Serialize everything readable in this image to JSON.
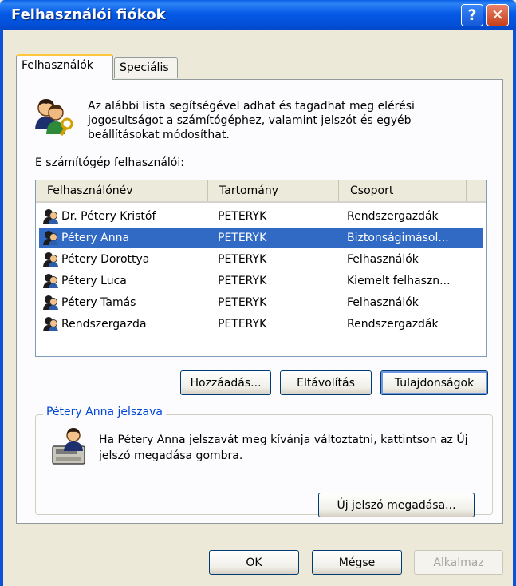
{
  "window": {
    "title": "Felhasználói fiókok",
    "help_label": "?",
    "close_label": "✕"
  },
  "tabs": [
    "Felhasználók",
    "Speciális"
  ],
  "intro": "Az alábbi lista segítségével adhat és tagadhat meg elérési jogosultságot a számítógéphez, valamint jelszót és egyéb beállításokat módosíthat.",
  "users_label": "E számítógép felhasználói:",
  "columns": [
    "Felhasználónév",
    "Tartomány",
    "Csoport"
  ],
  "users": [
    {
      "name": "Dr. Pétery Kristóf",
      "domain": "PETERYK",
      "group": "Rendszergazdák"
    },
    {
      "name": "Pétery Anna",
      "domain": "PETERYK",
      "group": "Biztonságimásol..."
    },
    {
      "name": "Pétery Dorottya",
      "domain": "PETERYK",
      "group": "Felhasználók"
    },
    {
      "name": "Pétery Luca",
      "domain": "PETERYK",
      "group": "Kiemelt felhaszn..."
    },
    {
      "name": "Pétery Tamás",
      "domain": "PETERYK",
      "group": "Felhasználók"
    },
    {
      "name": "Rendszergazda",
      "domain": "PETERYK",
      "group": "Rendszergazdák"
    }
  ],
  "selected_user_index": 1,
  "list_buttons": {
    "add": "Hozzáadás...",
    "remove": "Eltávolítás",
    "properties": "Tulajdonságok"
  },
  "password_group": {
    "label": "Pétery Anna jelszava",
    "text": "Ha Pétery Anna jelszavát meg kívánja változtatni, kattintson az Új jelszó megadása gombra.",
    "button": "Új jelszó megadása..."
  },
  "dialog_buttons": {
    "ok": "OK",
    "cancel": "Mégse",
    "apply": "Alkalmaz"
  },
  "colors": {
    "titlebar": "#0559e6",
    "selection": "#316ac5",
    "group_label": "#0046d5",
    "dialog_bg": "#ece9d8"
  }
}
